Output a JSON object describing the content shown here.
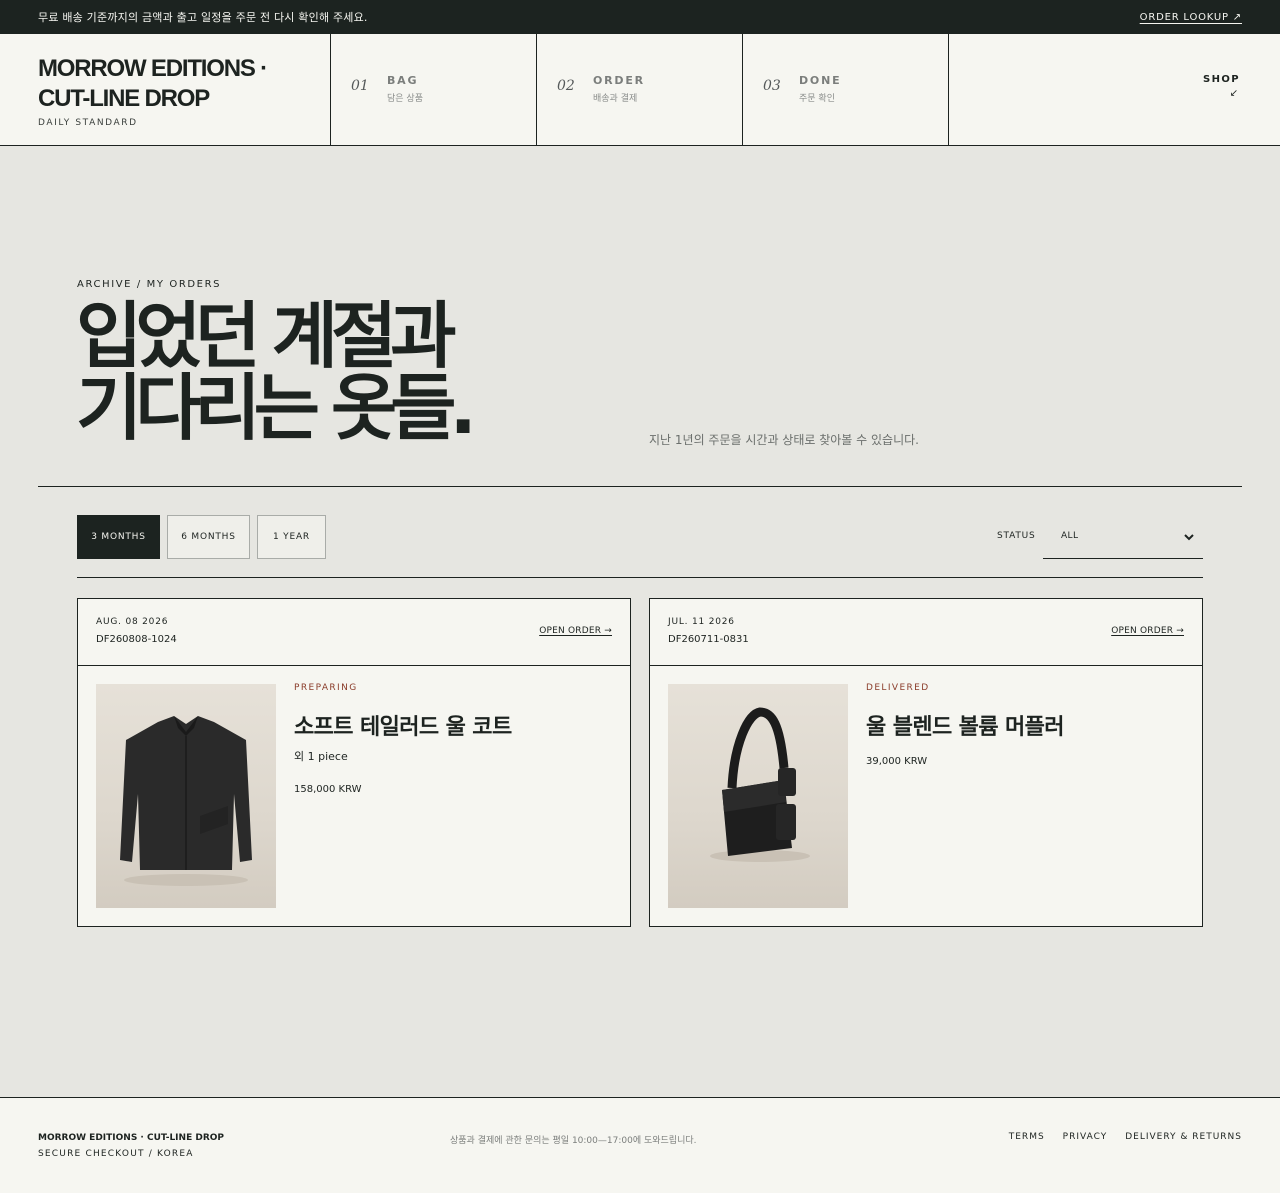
{
  "announcement": {
    "text": "무료 배송 기준까지의 금액과 출고 일정을 주문 전 다시 확인해 주세요.",
    "order_lookup": "ORDER LOOKUP ↗"
  },
  "header": {
    "brand_line1": "MORROW EDITIONS ·",
    "brand_line2": "CUT-LINE DROP",
    "tagline": "DAILY STANDARD",
    "steps": [
      {
        "num": "01",
        "title": "BAG",
        "sub": "담은 상품"
      },
      {
        "num": "02",
        "title": "ORDER",
        "sub": "배송과 결제"
      },
      {
        "num": "03",
        "title": "DONE",
        "sub": "주문 확인"
      }
    ],
    "shop_label": "SHOP",
    "shop_arrow": "↙"
  },
  "hero": {
    "eyebrow": "ARCHIVE / MY ORDERS",
    "title_line1": "입었던 계절과",
    "title_line2": "기다리는 옷들.",
    "description": "지난 1년의 주문을 시간과 상태로 찾아볼 수 있습니다."
  },
  "filters": {
    "periods": [
      "3 MONTHS",
      "6 MONTHS",
      "1 YEAR"
    ],
    "active_index": 0,
    "status_label": "STATUS",
    "status_value": "ALL"
  },
  "orders": [
    {
      "date": "AUG. 08 2026",
      "order_no": "DF260808-1024",
      "open_label": "OPEN ORDER →",
      "status": "PREPARING",
      "product_name": "소프트 테일러드 울 코트",
      "quantity_note": "외 1 piece",
      "price": "158,000 KRW",
      "image_icon": "jacket-image"
    },
    {
      "date": "JUL. 11 2026",
      "order_no": "DF260711-0831",
      "open_label": "OPEN ORDER →",
      "status": "DELIVERED",
      "product_name": "울 블렌드 볼륨 머플러",
      "price": "39,000 KRW",
      "image_icon": "bag-image"
    }
  ],
  "footer": {
    "brand": "MORROW EDITIONS · CUT-LINE DROP",
    "sub": "SECURE CHECKOUT / KOREA",
    "note": "상품과 결제에 관한 문의는 평일 10:00—17:00에 도와드립니다.",
    "links": [
      "TERMS",
      "PRIVACY",
      "DELIVERY & RETURNS"
    ]
  },
  "colors": {
    "ink": "#1d2320",
    "page_bg": "#e6e6e1",
    "panel_bg": "#f6f6f1",
    "status_accent": "#8a3c2a"
  }
}
